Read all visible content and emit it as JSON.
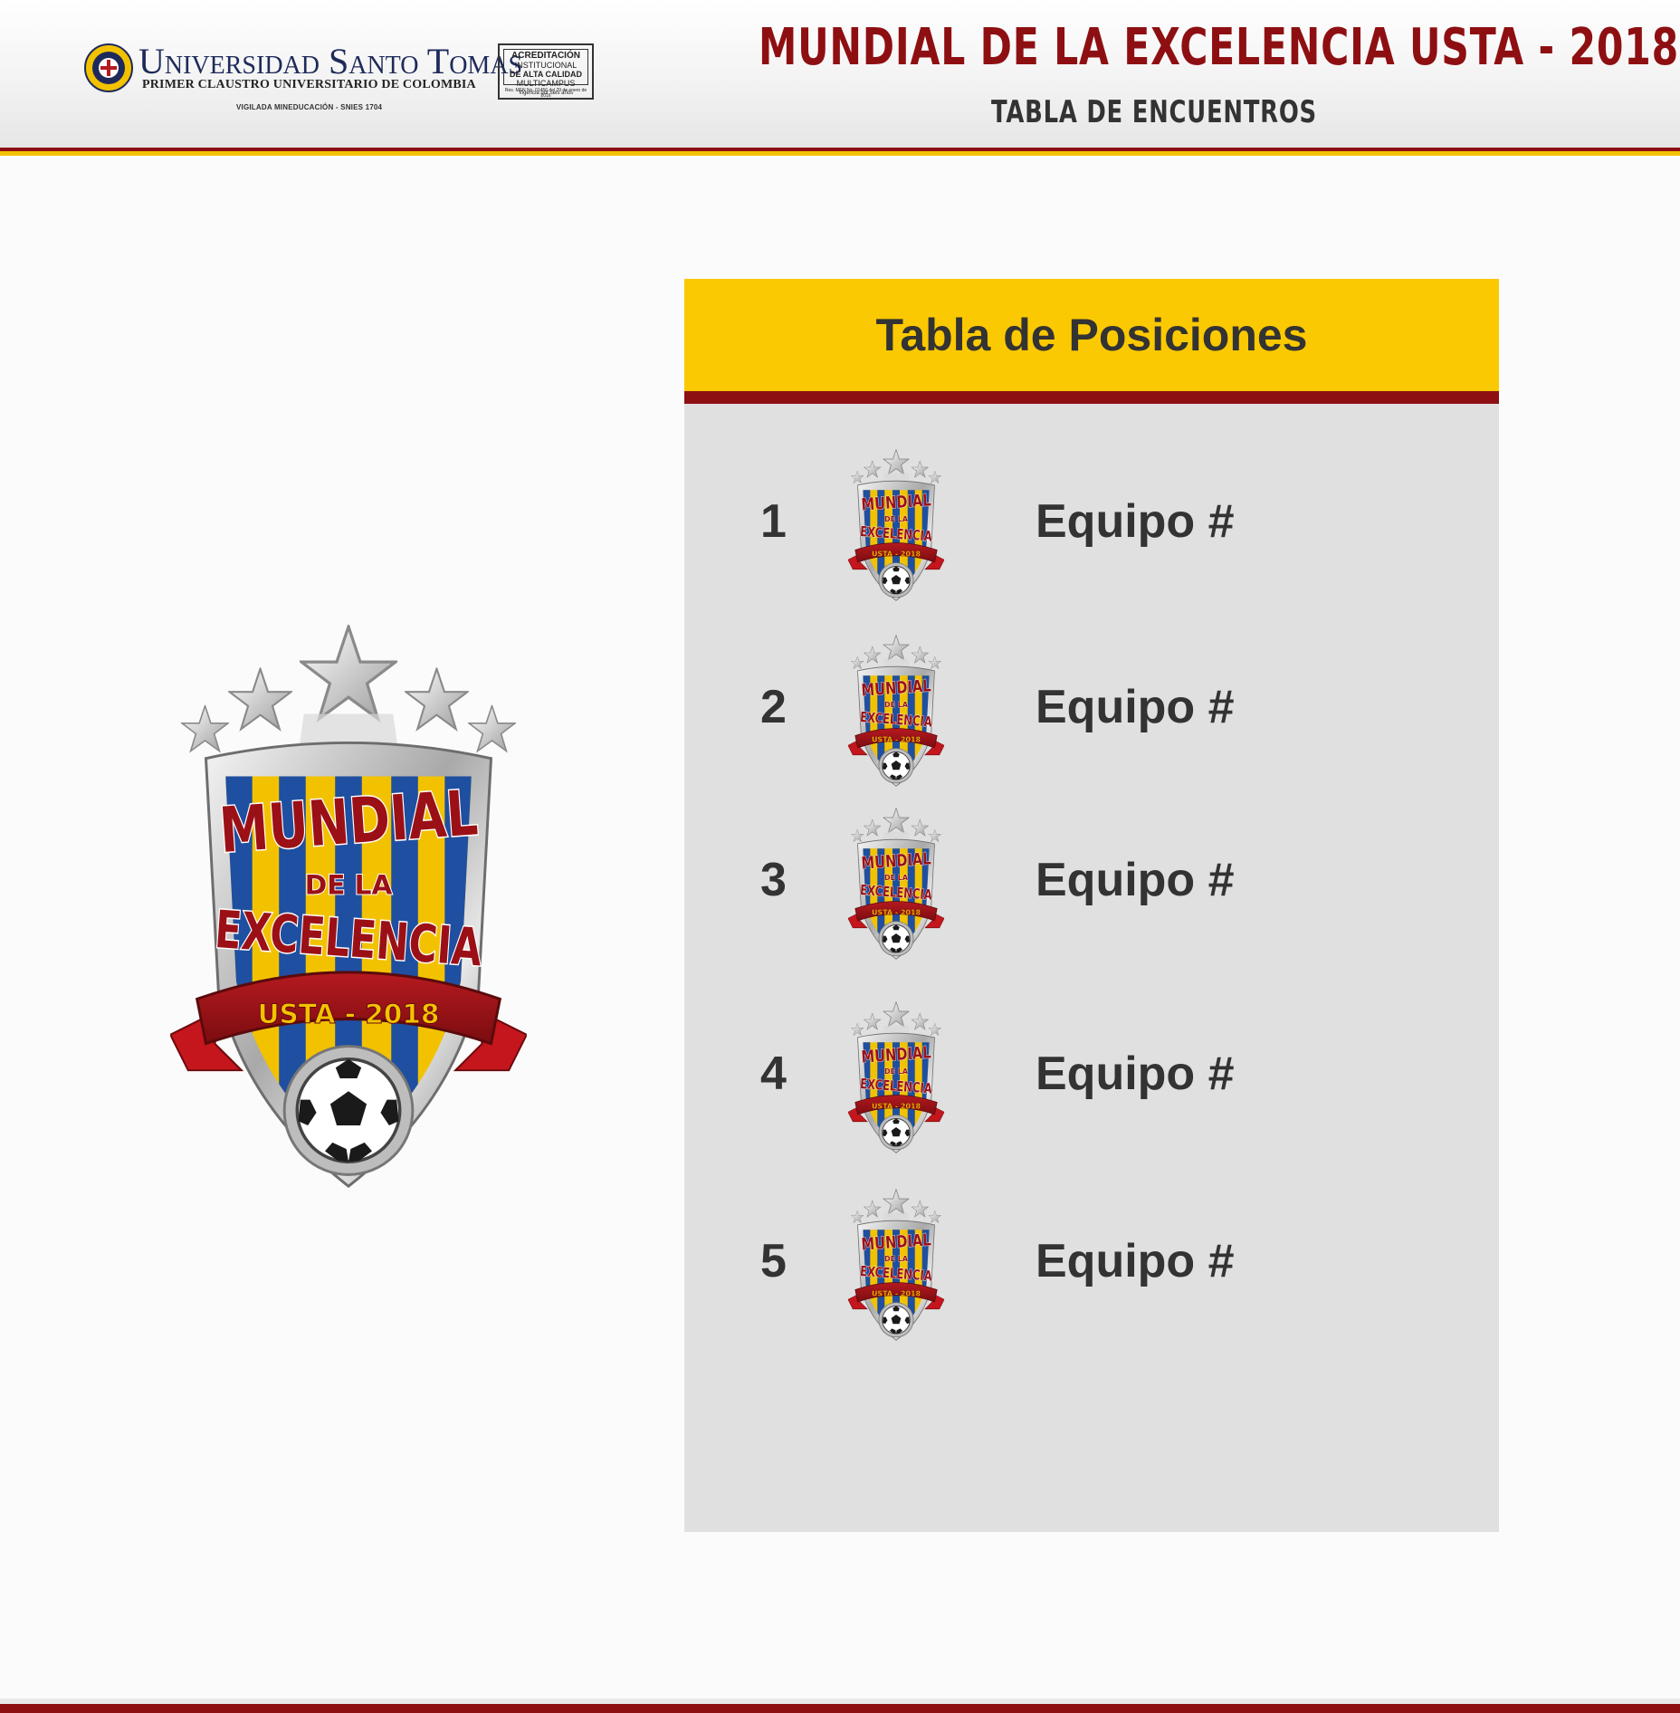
{
  "header": {
    "university_name": "Universidad Santo Tomas",
    "university_subtitle": "PRIMER CLAUSTRO UNIVERSITARIO DE COLOMBIA",
    "vigilada": "VIGILADA MINEDUCACIÓN - SNIES 1704",
    "accreditation": {
      "line1": "ACREDITACIÓN",
      "line2": "INSTITUCIONAL",
      "line3": "DE ALTA CALIDAD",
      "line4": "MULTICAMPUS",
      "line5": "Res. MEN No. 01456 del 29 de enero de 2016",
      "line6": "Vigencia por seis años"
    },
    "event_title": "MUNDIAL DE LA EXCELENCIA USTA - 2018",
    "event_subtitle": "TABLA DE ENCUENTROS"
  },
  "emblem": {
    "line1": "MUNDIAL",
    "line2": "DE LA",
    "line3": "EXCELENCIA",
    "ribbon": "USTA - 2018"
  },
  "standings": {
    "title": "Tabla de Posiciones",
    "rows": [
      {
        "rank": "1",
        "team": "Equipo #"
      },
      {
        "rank": "2",
        "team": "Equipo #"
      },
      {
        "rank": "3",
        "team": "Equipo #"
      },
      {
        "rank": "4",
        "team": "Equipo #"
      },
      {
        "rank": "5",
        "team": "Equipo #"
      }
    ]
  },
  "colors": {
    "brand_red": "#8e0f12",
    "brand_gold": "#fbc901",
    "stripe_blue": "#1f4fa0",
    "stripe_yellow": "#f2c200",
    "panel_gray": "#e0e0e0",
    "text_dark": "#333333"
  },
  "icons": [
    "usta-seal-icon",
    "accreditation-badge-icon",
    "mundial-emblem-icon",
    "soccer-ball-icon",
    "star-icon"
  ]
}
